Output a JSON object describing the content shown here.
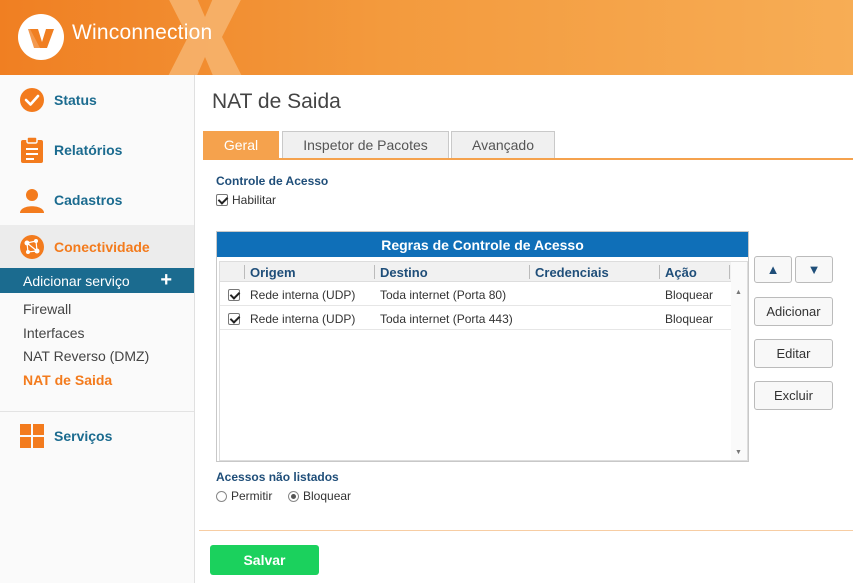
{
  "header": {
    "brand": "Winconnection"
  },
  "sidebar": {
    "items": [
      {
        "label": "Status",
        "icon": "check-circle-icon"
      },
      {
        "label": "Relatórios",
        "icon": "clipboard-icon"
      },
      {
        "label": "Cadastros",
        "icon": "user-icon"
      },
      {
        "label": "Conectividade",
        "icon": "network-globe-icon"
      },
      {
        "label": "Serviços",
        "icon": "grid-squares-icon"
      }
    ],
    "add_service": {
      "label": "Adicionar serviço",
      "plus": "+"
    },
    "sub_items": [
      "Firewall",
      "Interfaces",
      "NAT Reverso (DMZ)",
      "NAT de Saida"
    ],
    "active_sub": "NAT de Saida"
  },
  "main": {
    "title": "NAT de Saida",
    "tabs": [
      "Geral",
      "Inspetor de Pacotes",
      "Avançado"
    ],
    "active_tab": "Geral",
    "access_control": {
      "label": "Controle de Acesso",
      "enable_label": "Habilitar",
      "enabled": true
    },
    "grid": {
      "title": "Regras de Controle de Acesso",
      "columns": [
        "Origem",
        "Destino",
        "Credenciais",
        "Ação"
      ],
      "rows": [
        {
          "checked": true,
          "origem": "Rede interna (UDP)",
          "destino": "Toda internet (Porta 80)",
          "credenciais": "",
          "acao": "Bloquear"
        },
        {
          "checked": true,
          "origem": "Rede interna (UDP)",
          "destino": "Toda internet (Porta 443)",
          "credenciais": "",
          "acao": "Bloquear"
        }
      ]
    },
    "side_buttons": {
      "up": "▲",
      "down": "▼",
      "add": "Adicionar",
      "edit": "Editar",
      "delete": "Excluir"
    },
    "unlisted": {
      "label": "Acessos não listados",
      "allow": "Permitir",
      "block": "Bloquear",
      "selected": "Bloquear"
    },
    "save_label": "Salvar"
  },
  "colors": {
    "orange": "#f37b1d",
    "blue": "#0f6fb8",
    "teal_blue": "#1b6b8f",
    "green": "#1bd15d"
  }
}
